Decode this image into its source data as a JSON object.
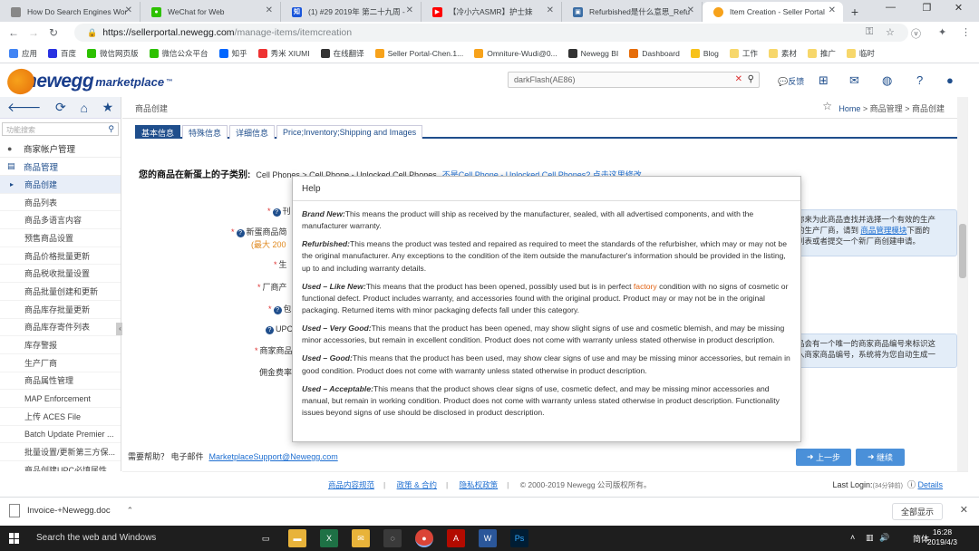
{
  "browser": {
    "tabs": [
      {
        "label": "How Do Search Engines Wor",
        "color": "#888888",
        "icon": "page-icon"
      },
      {
        "label": "WeChat for Web",
        "color": "#2dc100",
        "icon": "wechat-icon"
      },
      {
        "label": "(1) #29 2019年 第二十九周 -",
        "color": "#1a56db",
        "icon": "zhihu-icon"
      },
      {
        "label": "【冷小六ASMR】护士妹",
        "color": "#ff0000",
        "icon": "youtube-icon"
      },
      {
        "label": "Refurbished是什么意思_Refu",
        "color": "#3b6ea5",
        "icon": "dict-icon"
      },
      {
        "label": "Item Creation - Seller Portal",
        "color": "#f7a21b",
        "icon": "newegg-icon"
      }
    ],
    "url_host": "https://sellerportal.newegg.com",
    "url_path": "/manage-items/itemcreation",
    "bookmarks": [
      {
        "label": "应用",
        "color": "#4285f4"
      },
      {
        "label": "百度",
        "color": "#2932e1"
      },
      {
        "label": "微信网页版",
        "color": "#2dc100"
      },
      {
        "label": "微信公众平台",
        "color": "#2dc100"
      },
      {
        "label": "知乎",
        "color": "#0066ff"
      },
      {
        "label": "秀米 XIUMI",
        "color": "#e33"
      },
      {
        "label": "在线翻译",
        "color": "#333"
      },
      {
        "label": "Seller Portal-Chen.1...",
        "color": "#f7a21b"
      },
      {
        "label": "Omniture-Wudi@0...",
        "color": "#f7a21b"
      },
      {
        "label": "Newegg BI",
        "color": "#333"
      },
      {
        "label": "Dashboard",
        "color": "#e66d0a"
      },
      {
        "label": "Blog",
        "color": "#f7c21b"
      },
      {
        "label": "工作",
        "color": "#f7d76b"
      },
      {
        "label": "素材",
        "color": "#f7d76b"
      },
      {
        "label": "推广",
        "color": "#f7d76b"
      },
      {
        "label": "临时",
        "color": "#f7d76b"
      }
    ]
  },
  "header": {
    "logo_word": "newegg",
    "logo_suffix": "marketplace",
    "logo_tm": "™",
    "search_value": "darkFlash(AE86)",
    "feedback": "反馈"
  },
  "sidebar": {
    "search_placeholder": "功能搜索",
    "groups": [
      {
        "label": "商家帐户管理",
        "open": false
      },
      {
        "label": "商品管理",
        "open": true
      }
    ],
    "items": [
      "商品创建",
      "商品列表",
      "商品多语言内容",
      "预售商品设置",
      "商品价格批量更新",
      "商品税收批量设置",
      "商品批量创建和更新",
      "商品库存批量更新",
      "商品库存寄件列表",
      "库存警报",
      "生产厂商",
      "商品属性管理",
      "MAP Enforcement",
      "上传 ACES File",
      "Batch Update Premier ...",
      "批量设置/更新第三方保...",
      "商品创建UPC必填属性..."
    ],
    "active_index": 0
  },
  "main": {
    "crumb_left": "商品创建",
    "crumb_home": "Home",
    "crumb_mid": "商品管理",
    "crumb_current": "商品创建",
    "crumb_sep": ">",
    "tabs": [
      "基本信息",
      "特殊信息",
      "详细信息",
      "Price;Inventory;Shipping and Images"
    ],
    "category_label": "您的商品在新蛋上的子类别:",
    "category_value": "Cell Phones > Cell Phone - Unlocked Cell Phones",
    "category_link": "不是Cell Phone - Unlocked Cell Phones? 点击这里修改。",
    "fields": {
      "f1": "刊",
      "f2": "新蛋商品简",
      "f2_sub": "(最大 200",
      "f3": "生",
      "f4": "厂商产",
      "f5": "包",
      "f6": "UPC",
      "f7": "商家商品",
      "f8": "佣金费率"
    },
    "info1_a": "称来为此商品查找并选择一个有效的生产",
    "info1_b": "的生产厂商，请到",
    "info1_link": "商品管理模块",
    "info1_c": "下面的",
    "info1_d": "列表或者提交一个新厂商创建申请。",
    "info2_a": "品会有一个唯一的商家商品编号来标识这",
    "info2_b": "入商家商品编号，系统将为您自动生成一",
    "help_prefix": "需要帮助？  电子邮件",
    "help_email": "MarketplaceSupport@Newegg.com",
    "btn_prev": "上一步",
    "btn_next": "继续"
  },
  "footer": {
    "links": [
      "商品内容规范",
      "政策 & 合约",
      "隐私权政策"
    ],
    "copyright": "© 2000-2019 Newegg 公司版权所有。",
    "last_login_label": "Last Login:",
    "last_login_value": "(34分钟前)",
    "details": "Details"
  },
  "help_popup": {
    "title": "Help",
    "entries": [
      {
        "term": "Brand New:",
        "text": "This means the product will ship as received by the manufacturer, sealed, with all advertised components, and with the manufacturer warranty."
      },
      {
        "term": "Refurbished:",
        "text": "This means the product was tested and repaired as required to meet the standards of the refurbisher, which may or may not be the original manufacturer. Any exceptions to the condition of the item outside the manufacturer's information should be provided in the listing, up to and including warranty details."
      },
      {
        "term": "Used – Like New:",
        "text_a": "This means that the product has been opened, possibly used but is in perfect ",
        "text_highlight": "factory",
        "text_b": " condition with no signs of cosmetic or functional defect. Product includes warranty, and accessories found with the original product. Product may or may not be in the original packaging. Returned items with minor packaging defects fall under this category."
      },
      {
        "term": "Used – Very Good:",
        "text": "This means that the product has been opened, may show slight signs of use and cosmetic blemish, and may be missing minor accessories, but remain in excellent condition. Product does not come with warranty unless stated otherwise in product description."
      },
      {
        "term": "Used – Good:",
        "text": "This means that the product has been used, may show clear signs of use and may be missing minor accessories, but remain in good condition. Product does not come with warranty unless stated otherwise in product description."
      },
      {
        "term": "Used – Acceptable:",
        "text": "This means that the product shows clear signs of use, cosmetic defect, and may be missing minor accessories and manual, but remain in working condition. Product does not come with warranty unless stated otherwise in product description. Functionality issues beyond signs of use should be disclosed in product description."
      }
    ]
  },
  "download_bar": {
    "filename": "Invoice-+Newegg.doc",
    "show_all": "全部显示"
  },
  "taskbar": {
    "search_placeholder": "Search the web and Windows",
    "ime": "简体",
    "time": "16:28",
    "date": "2019/4/3"
  },
  "colors": {
    "brand_blue": "#1f4e8c",
    "brand_orange": "#f7a21b",
    "link_blue": "#1f6fd1",
    "button_blue": "#4a90d9"
  }
}
